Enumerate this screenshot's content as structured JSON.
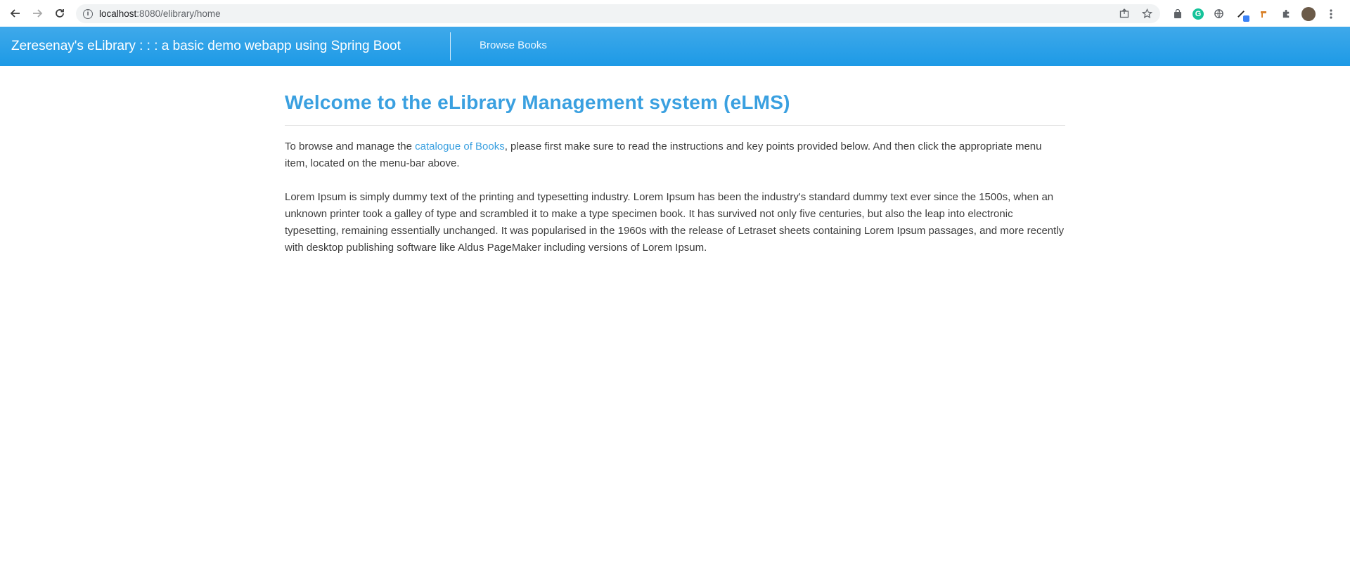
{
  "browser": {
    "url_host": "localhost",
    "url_path": ":8080/elibrary/home",
    "icons": {
      "back": "back-arrow-icon",
      "forward": "forward-arrow-icon",
      "reload": "reload-icon",
      "info": "info-icon",
      "share": "share-icon",
      "bookmark": "star-icon",
      "extensions": "puzzle-icon",
      "menu": "kebab-menu-icon"
    }
  },
  "navbar": {
    "brand": "Zeresenay's eLibrary : : : a basic demo webapp using Spring Boot",
    "links": [
      {
        "label": "Browse Books"
      }
    ],
    "color": "#1d9ae6"
  },
  "main": {
    "title": "Welcome to the eLibrary Management system (eLMS)",
    "intro_before": "To browse and manage the ",
    "intro_link": "catalogue of Books",
    "intro_after": ", please first make sure to read the instructions and key points provided below. And then click the appropriate menu item, located on the menu-bar above.",
    "lorem": "Lorem Ipsum is simply dummy text of the printing and typesetting industry. Lorem Ipsum has been the industry's standard dummy text ever since the 1500s, when an unknown printer took a galley of type and scrambled it to make a type specimen book. It has survived not only five centuries, but also the leap into electronic typesetting, remaining essentially unchanged. It was popularised in the 1960s with the release of Letraset sheets containing Lorem Ipsum passages, and more recently with desktop publishing software like Aldus PageMaker including versions of Lorem Ipsum."
  },
  "colors": {
    "accent": "#3aa0e0",
    "text": "#3d3d3d"
  }
}
